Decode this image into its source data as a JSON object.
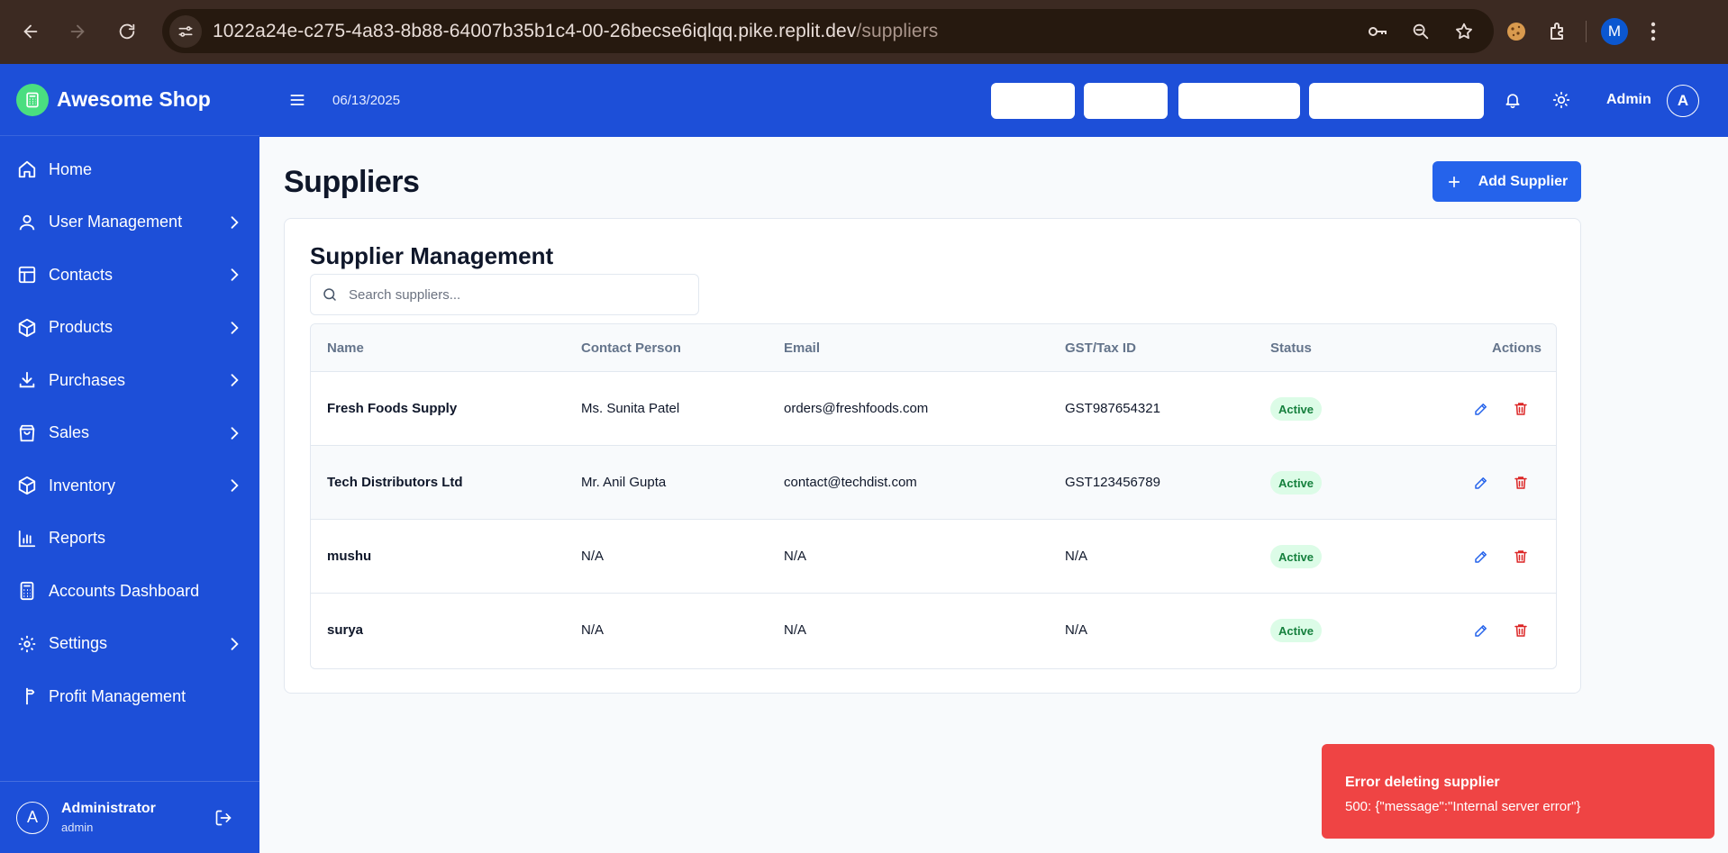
{
  "browser": {
    "url_host": "1022a24e-c275-4a83-8b88-64007b35b1c4-00-26becse6iqlqq.pike.replit.dev",
    "url_path": "/suppliers",
    "profile_initial": "M"
  },
  "sidebar": {
    "brand": "Awesome Shop",
    "items": [
      {
        "label": "Home",
        "icon": "home-icon",
        "chevron": false
      },
      {
        "label": "User Management",
        "icon": "user-icon",
        "chevron": true
      },
      {
        "label": "Contacts",
        "icon": "layout-icon",
        "chevron": true
      },
      {
        "label": "Products",
        "icon": "package-icon",
        "chevron": true
      },
      {
        "label": "Purchases",
        "icon": "download-icon",
        "chevron": true
      },
      {
        "label": "Sales",
        "icon": "shopping-bag-icon",
        "chevron": true
      },
      {
        "label": "Inventory",
        "icon": "package-icon",
        "chevron": true
      },
      {
        "label": "Reports",
        "icon": "bar-chart-icon",
        "chevron": false
      },
      {
        "label": "Accounts Dashboard",
        "icon": "calculator-icon",
        "chevron": false
      },
      {
        "label": "Settings",
        "icon": "gear-icon",
        "chevron": true
      },
      {
        "label": "Profit Management",
        "icon": "signpost-icon",
        "chevron": false
      }
    ],
    "user": {
      "initial": "A",
      "name": "Administrator",
      "role": "admin"
    }
  },
  "header": {
    "date": "06/13/2025",
    "admin_label": "Admin",
    "admin_initial": "A"
  },
  "main": {
    "title": "Suppliers",
    "add_button": "Add Supplier",
    "card_title": "Supplier Management",
    "search_placeholder": "Search suppliers...",
    "columns": [
      "Name",
      "Contact Person",
      "Email",
      "GST/Tax ID",
      "Status",
      "Actions"
    ],
    "rows": [
      {
        "name": "Fresh Foods Supply",
        "contact": "Ms. Sunita Patel",
        "email": "orders@freshfoods.com",
        "gst": "GST987654321",
        "status": "Active"
      },
      {
        "name": "Tech Distributors Ltd",
        "contact": "Mr. Anil Gupta",
        "email": "contact@techdist.com",
        "gst": "GST123456789",
        "status": "Active"
      },
      {
        "name": "mushu",
        "contact": "N/A",
        "email": "N/A",
        "gst": "N/A",
        "status": "Active"
      },
      {
        "name": "surya",
        "contact": "N/A",
        "email": "N/A",
        "gst": "N/A",
        "status": "Active"
      }
    ]
  },
  "toast": {
    "title": "Error deleting supplier",
    "message": "500: {\"message\":\"Internal server error\"}"
  },
  "colors": {
    "primary": "#1d4fd8",
    "button": "#2563eb",
    "error": "#ef4444",
    "badge_bg": "#dcfce7",
    "badge_text": "#15803d",
    "edit_icon": "#2563eb",
    "delete_icon": "#dc2626"
  }
}
